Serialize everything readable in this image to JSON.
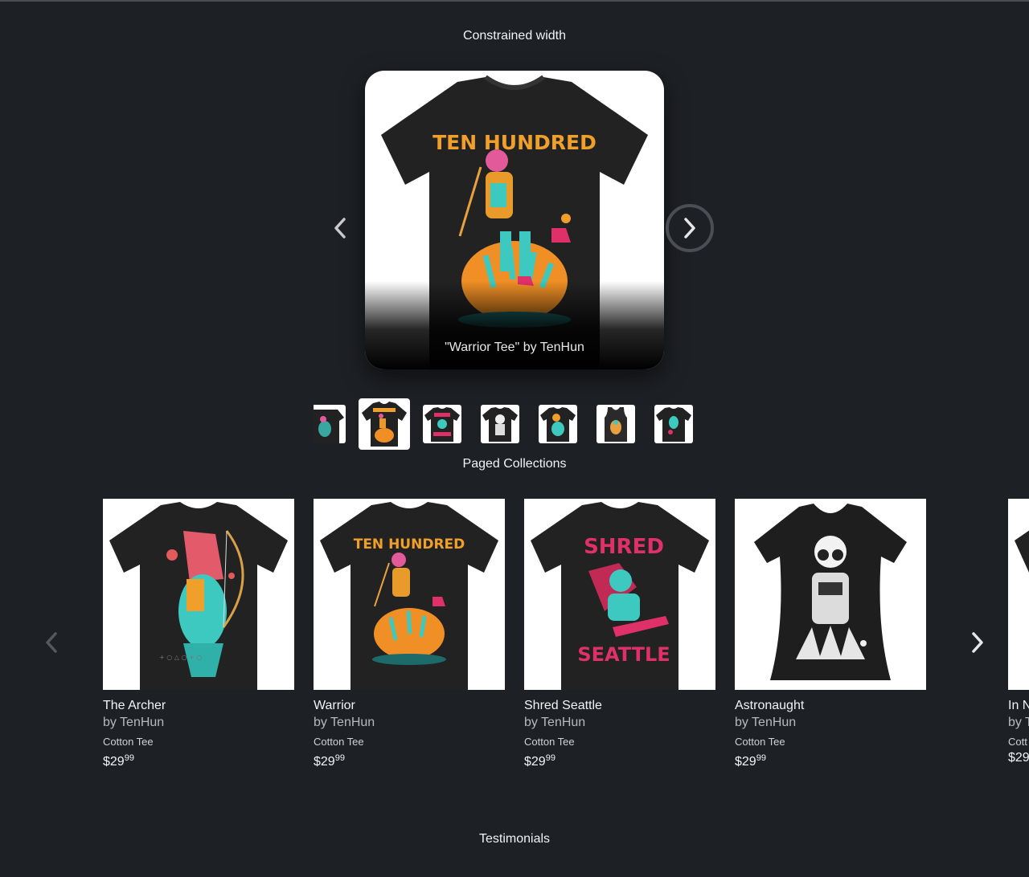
{
  "sections": {
    "constrained_title": "Constrained width",
    "paged_title": "Paged Collections",
    "testimonials_title": "Testimonials"
  },
  "hero": {
    "caption": "\"Warrior Tee\" by TenHun",
    "shirt_text": "TEN HUNDRED",
    "prev_icon": "chevron-left-icon",
    "next_icon": "chevron-right-icon"
  },
  "thumbnails": [
    {
      "name": "partial-prev"
    },
    {
      "name": "warrior",
      "active": true
    },
    {
      "name": "shred-seattle"
    },
    {
      "name": "astronaught"
    },
    {
      "name": "archer-green"
    },
    {
      "name": "tank-top"
    },
    {
      "name": "green-character"
    }
  ],
  "products": [
    {
      "name": "The Archer",
      "by": "by TenHun",
      "kind": "Cotton Tee",
      "price_main": "$29",
      "price_cents": "99"
    },
    {
      "name": "Warrior",
      "by": "by TenHun",
      "kind": "Cotton Tee",
      "price_main": "$29",
      "price_cents": "99",
      "shirt_text": "TEN HUNDRED"
    },
    {
      "name": "Shred Seattle",
      "by": "by TenHun",
      "kind": "Cotton Tee",
      "price_main": "$29",
      "price_cents": "99",
      "shirt_top": "SHRED",
      "shirt_bottom": "SEATTLE"
    },
    {
      "name": "Astronaught",
      "by": "by TenHun",
      "kind": "Cotton Tee",
      "price_main": "$29",
      "price_cents": "99"
    },
    {
      "name": "In N",
      "by": "by T",
      "kind": "Cott",
      "price_main": "$29",
      "price_cents": ""
    }
  ],
  "colors": {
    "background": "#1d2025",
    "shirt": "#222222",
    "accent_orange": "#f0a02a",
    "accent_teal": "#3ec9c0",
    "accent_pink": "#e0306a"
  }
}
